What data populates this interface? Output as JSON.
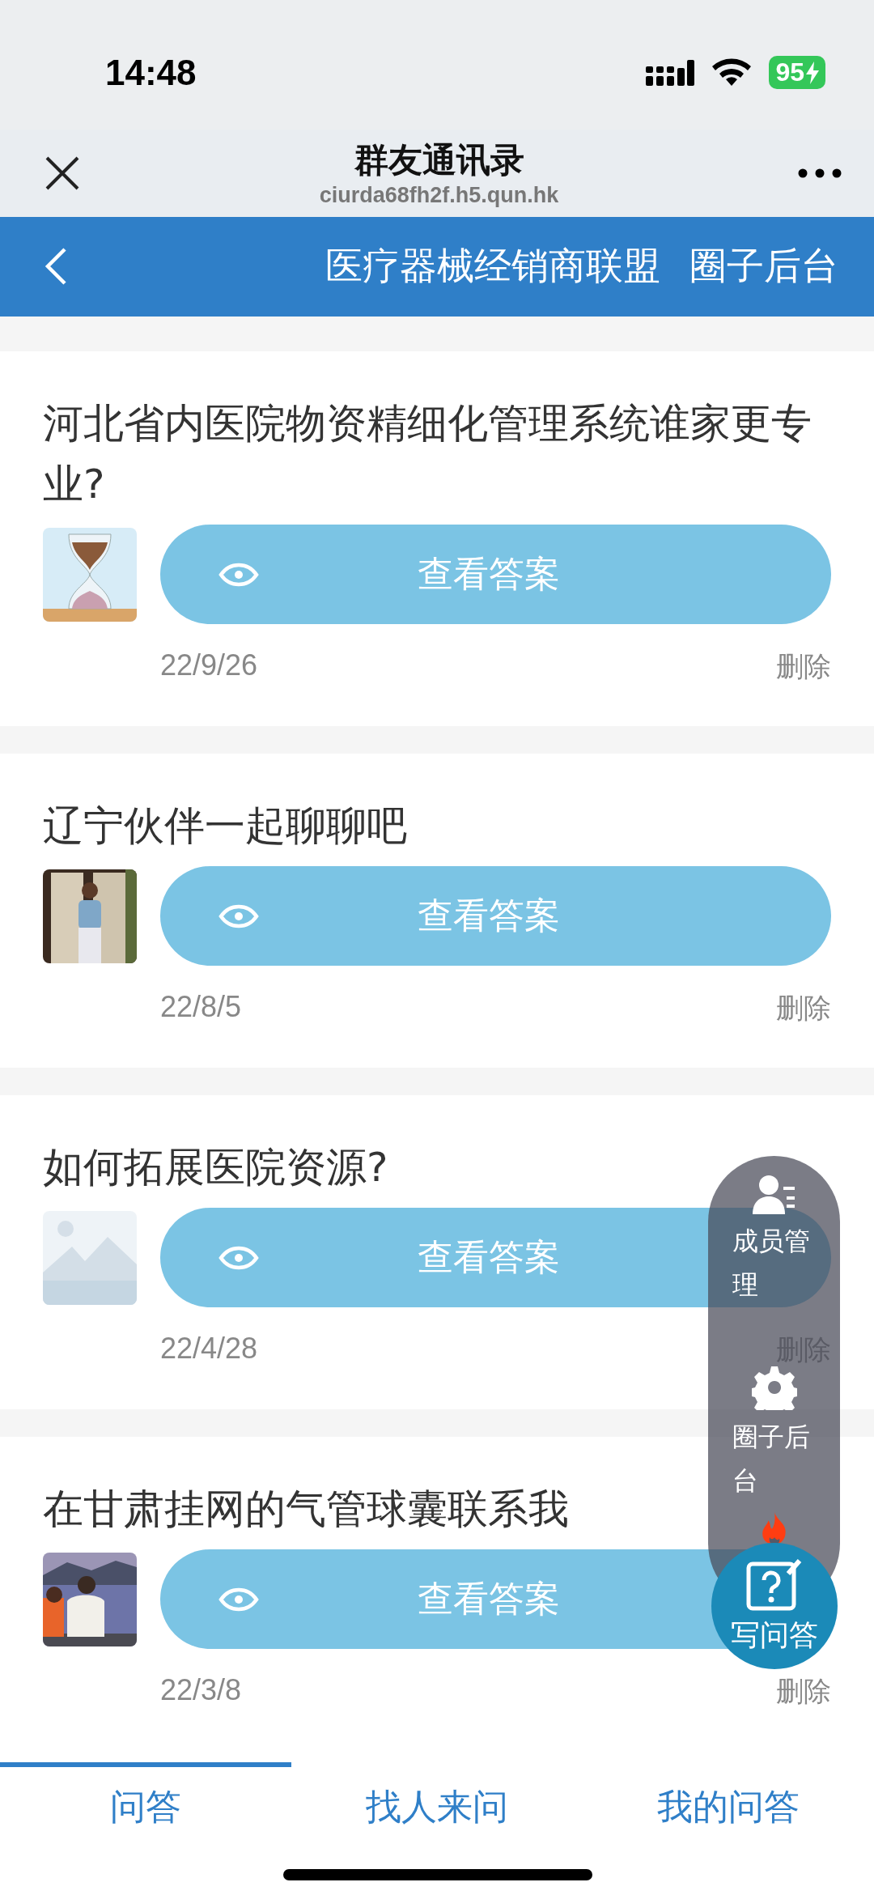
{
  "status_bar": {
    "time": "14:48",
    "battery": "95"
  },
  "browser": {
    "title": "群友通讯录",
    "url": "ciurda68fh2f.h5.qun.hk"
  },
  "header": {
    "group": "医疗器械经销商联盟",
    "action": "圈子后台"
  },
  "questions": [
    {
      "title": "河北省内医院物资精细化管理系统谁家更专业?",
      "button": "查看答案",
      "date": "22/9/26",
      "delete": "删除"
    },
    {
      "title": "辽宁伙伴一起聊聊吧",
      "button": "查看答案",
      "date": "22/8/5",
      "delete": "删除"
    },
    {
      "title": "如何拓展医院资源?",
      "button": "查看答案",
      "date": "22/4/28",
      "delete": "删除"
    },
    {
      "title": "在甘肃挂网的气管球囊联系我",
      "button": "查看答案",
      "date": "22/3/8",
      "delete": "删除"
    }
  ],
  "floating_menu": {
    "items": [
      {
        "kind": "members",
        "label": "成员管理"
      },
      {
        "kind": "settings",
        "label": "圈子后台"
      },
      {
        "kind": "hot"
      }
    ],
    "write_button": "写问答"
  },
  "tabs": [
    {
      "label": "问答",
      "selected": true
    },
    {
      "label": "找人来问",
      "selected": false
    },
    {
      "label": "我的问答",
      "selected": false
    }
  ]
}
